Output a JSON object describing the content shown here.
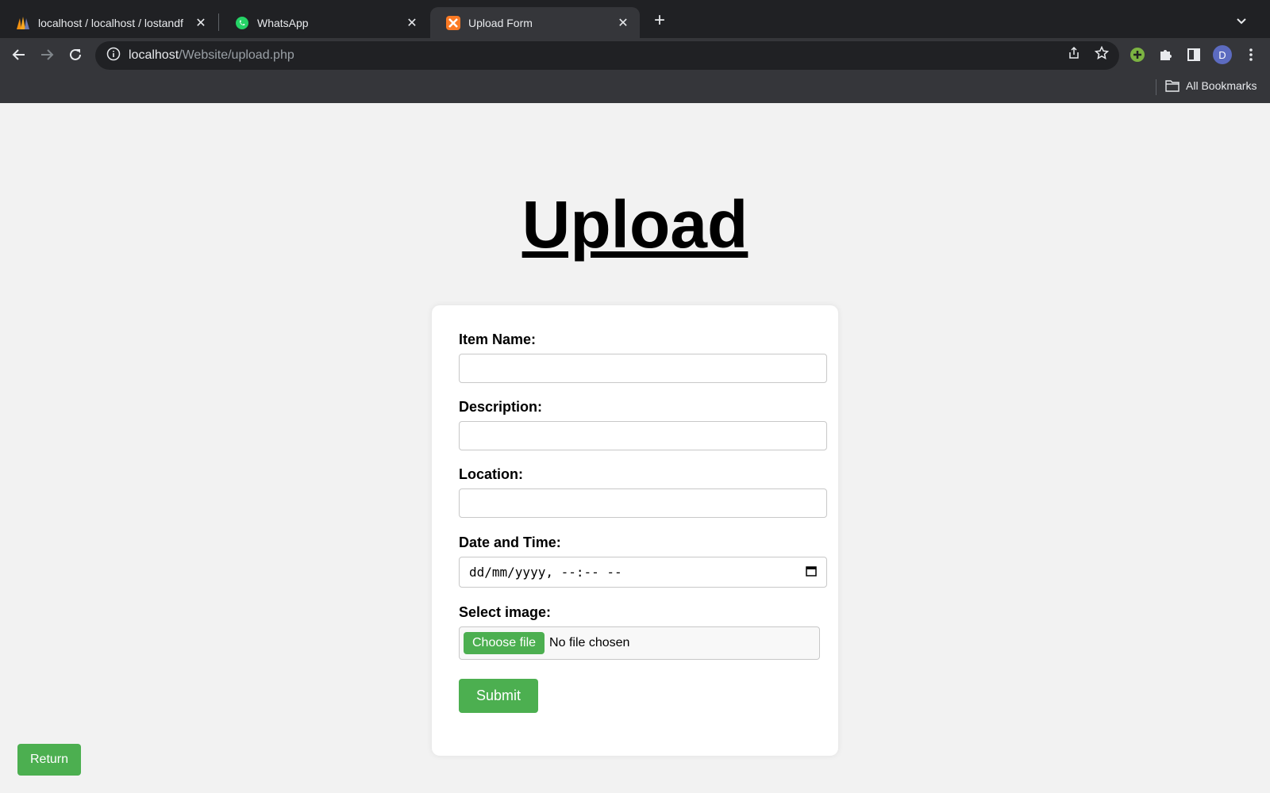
{
  "browser": {
    "tabs": [
      {
        "title": "localhost / localhost / lostandf",
        "favicon": "phpmyadmin-icon",
        "active": false
      },
      {
        "title": "WhatsApp",
        "favicon": "whatsapp-icon",
        "active": false
      },
      {
        "title": "Upload Form",
        "favicon": "xampp-icon",
        "active": true
      }
    ],
    "url_host": "localhost",
    "url_path": "/Website/upload.php",
    "profile_initial": "D",
    "bookmarks_label": "All Bookmarks"
  },
  "page": {
    "heading": "Upload",
    "form": {
      "item_name_label": "Item Name:",
      "item_name_value": "",
      "description_label": "Description:",
      "description_value": "",
      "location_label": "Location:",
      "location_value": "",
      "datetime_label": "Date and Time:",
      "datetime_placeholder": "dd/mm/yyyy, --:-- --",
      "image_label": "Select image:",
      "choose_file_label": "Choose file",
      "no_file_text": "No file chosen",
      "submit_label": "Submit"
    },
    "return_label": "Return"
  },
  "colors": {
    "accent_green": "#4caf50",
    "page_background": "#f2f2f2",
    "chrome_dark": "#202124",
    "chrome_toolbar": "#35363a"
  }
}
